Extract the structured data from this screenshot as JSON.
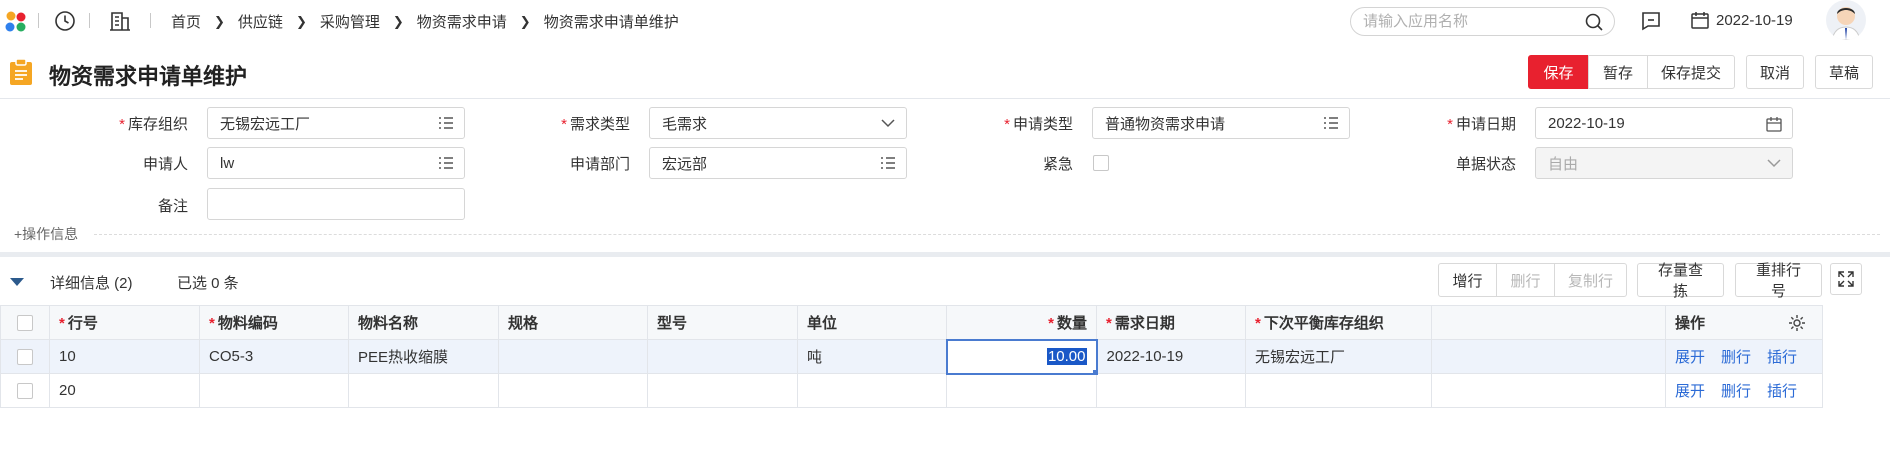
{
  "topbar": {
    "breadcrumbs": [
      "首页",
      "供应链",
      "采购管理",
      "物资需求申请",
      "物资需求申请单维护"
    ],
    "search_placeholder": "请输入应用名称",
    "date": "2022-10-19"
  },
  "header": {
    "title": "物资需求申请单维护",
    "buttons": {
      "save": "保存",
      "temp_save": "暂存",
      "save_submit": "保存提交",
      "cancel": "取消",
      "draft": "草稿"
    }
  },
  "form": {
    "stock_org": {
      "label": "库存组织",
      "value": "无锡宏远工厂"
    },
    "demand_type": {
      "label": "需求类型",
      "value": "毛需求"
    },
    "apply_type": {
      "label": "申请类型",
      "value": "普通物资需求申请"
    },
    "apply_date": {
      "label": "申请日期",
      "value": "2022-10-19"
    },
    "applicant": {
      "label": "申请人",
      "value": "lw"
    },
    "apply_dept": {
      "label": "申请部门",
      "value": "宏远部"
    },
    "urgent": {
      "label": "紧急",
      "checked": false
    },
    "doc_status": {
      "label": "单据状态",
      "value": "自由"
    },
    "remark": {
      "label": "备注",
      "value": ""
    },
    "op_info": "+操作信息"
  },
  "detail": {
    "title": "详细信息 (2)",
    "selected": "已选 0 条",
    "buttons": {
      "add_row": "增行",
      "del_row": "删行",
      "copy_row": "复制行",
      "stock_query": "存量查拣",
      "renumber": "重排行号"
    },
    "columns": {
      "row_no": "行号",
      "material_code": "物料编码",
      "material_name": "物料名称",
      "spec": "规格",
      "model": "型号",
      "unit": "单位",
      "quantity": "数量",
      "demand_date": "需求日期",
      "balance_org": "下次平衡库存组织",
      "blank": "",
      "ops": "操作"
    },
    "rows": [
      {
        "row_no": "10",
        "material_code": "CO5-3",
        "material_name": "PEE热收缩膜",
        "spec": "",
        "model": "",
        "unit": "吨",
        "quantity": "10.00",
        "demand_date": "2022-10-19",
        "balance_org": "无锡宏远工厂",
        "blank": "",
        "op1": "展开",
        "op2": "删行",
        "op3": "插行"
      },
      {
        "row_no": "20",
        "material_code": "",
        "material_name": "",
        "spec": "",
        "model": "",
        "unit": "",
        "quantity": "",
        "demand_date": "",
        "balance_org": "",
        "blank": "",
        "op1": "展开",
        "op2": "删行",
        "op3": "插行"
      }
    ]
  },
  "colors": {
    "primary": "#e8212f",
    "link": "#2c6bd6",
    "selection": "#1a58c7"
  }
}
